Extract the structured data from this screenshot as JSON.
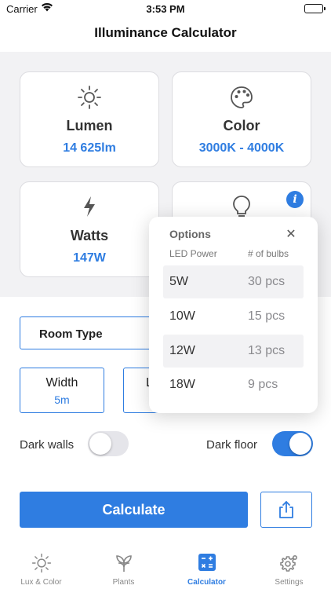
{
  "status": {
    "carrier": "Carrier",
    "time": "3:53 PM"
  },
  "nav": {
    "title": "Illuminance Calculator"
  },
  "cards": {
    "lumen": {
      "title": "Lumen",
      "value": "14 625lm"
    },
    "color": {
      "title": "Color",
      "value": "3000K - 4000K"
    },
    "watts": {
      "title": "Watts",
      "value": "147W"
    }
  },
  "form": {
    "room_type": "Room Type",
    "width_label": "Width",
    "width_value": "5m",
    "length_label_partial": "L",
    "dark_walls_label": "Dark walls",
    "dark_walls_on": false,
    "dark_floor_label": "Dark floor",
    "dark_floor_on": true,
    "calculate_label": "Calculate"
  },
  "popover": {
    "title": "Options",
    "col_power": "LED Power",
    "col_bulbs": "# of bulbs",
    "rows": [
      {
        "power": "5W",
        "bulbs": "30 pcs"
      },
      {
        "power": "10W",
        "bulbs": "15 pcs"
      },
      {
        "power": "12W",
        "bulbs": "13 pcs"
      },
      {
        "power": "18W",
        "bulbs": "9 pcs"
      }
    ]
  },
  "tabs": [
    {
      "label": "Lux & Color",
      "icon": "sun-icon"
    },
    {
      "label": "Plants",
      "icon": "plant-icon"
    },
    {
      "label": "Calculator",
      "icon": "calculator-icon",
      "active": true
    },
    {
      "label": "Settings",
      "icon": "gear-icon"
    }
  ],
  "colors": {
    "accent": "#2f7de1",
    "background_grey": "#f2f2f4"
  }
}
